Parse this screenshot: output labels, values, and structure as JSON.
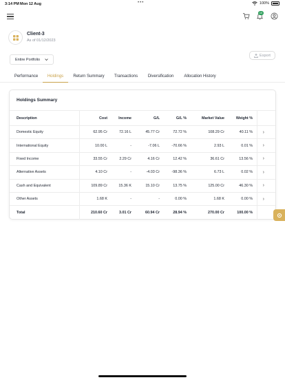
{
  "status": {
    "time": "3:14 PM",
    "date": "Mon 12 Aug",
    "battery": "100%"
  },
  "header": {
    "notifications_count": "10"
  },
  "client": {
    "name": "Client-3",
    "as_of": "As of 01/12/2023"
  },
  "portfolio": {
    "selected": "Entire Portfolio"
  },
  "export": {
    "label": "Export"
  },
  "tabs": [
    {
      "label": "Performance"
    },
    {
      "label": "Holdings"
    },
    {
      "label": "Return Summary"
    },
    {
      "label": "Transactions"
    },
    {
      "label": "Diversification"
    },
    {
      "label": "Allocation History"
    }
  ],
  "active_tab": "Holdings",
  "colors": {
    "accent": "#c9a24a",
    "badge": "#2e9e5b",
    "floating": "#d9b25c"
  },
  "holdings": {
    "title": "Holdings Summary",
    "columns": {
      "description": "Description",
      "cost": "Cost",
      "income": "Income",
      "gl": "G/L",
      "gl_pct": "G/L %",
      "market_value": "Market Value",
      "weight": "Weight %"
    },
    "rows": [
      {
        "description": "Domestic Equity",
        "cost": "62.95 Cr",
        "income": "72.16 L",
        "gl": "45.77 Cr",
        "gl_pct": "72.72 %",
        "market_value": "108.29 Cr",
        "weight": "40.11 %"
      },
      {
        "description": "International Equity",
        "cost": "10.00 L",
        "income": "-",
        "gl": "-7.06 L",
        "gl_pct": "-70.66 %",
        "market_value": "2.93 L",
        "weight": "0.01 %"
      },
      {
        "description": "Fixed Income",
        "cost": "33.55 Cr",
        "income": "2.29 Cr",
        "gl": "4.16 Cr",
        "gl_pct": "12.42 %",
        "market_value": "36.61 Cr",
        "weight": "13.56 %"
      },
      {
        "description": "Alternative Assets",
        "cost": "4.10 Cr",
        "income": "-",
        "gl": "-4.03 Cr",
        "gl_pct": "-98.36 %",
        "market_value": "6.73 L",
        "weight": "0.02 %"
      },
      {
        "description": "Cash and Equivalent",
        "cost": "109.89 Cr",
        "income": "15.36 K",
        "gl": "15.10 Cr",
        "gl_pct": "13.75 %",
        "market_value": "125.00 Cr",
        "weight": "46.30 %"
      },
      {
        "description": "Other Assets",
        "cost": "1.68 K",
        "income": "-",
        "gl": "-",
        "gl_pct": "0.00 %",
        "market_value": "1.68 K",
        "weight": "0.00 %"
      }
    ],
    "total": {
      "description": "Total",
      "cost": "210.60 Cr",
      "income": "3.01 Cr",
      "gl": "60.94 Cr",
      "gl_pct": "28.94 %",
      "market_value": "270.00 Cr",
      "weight": "100.00 %"
    }
  }
}
